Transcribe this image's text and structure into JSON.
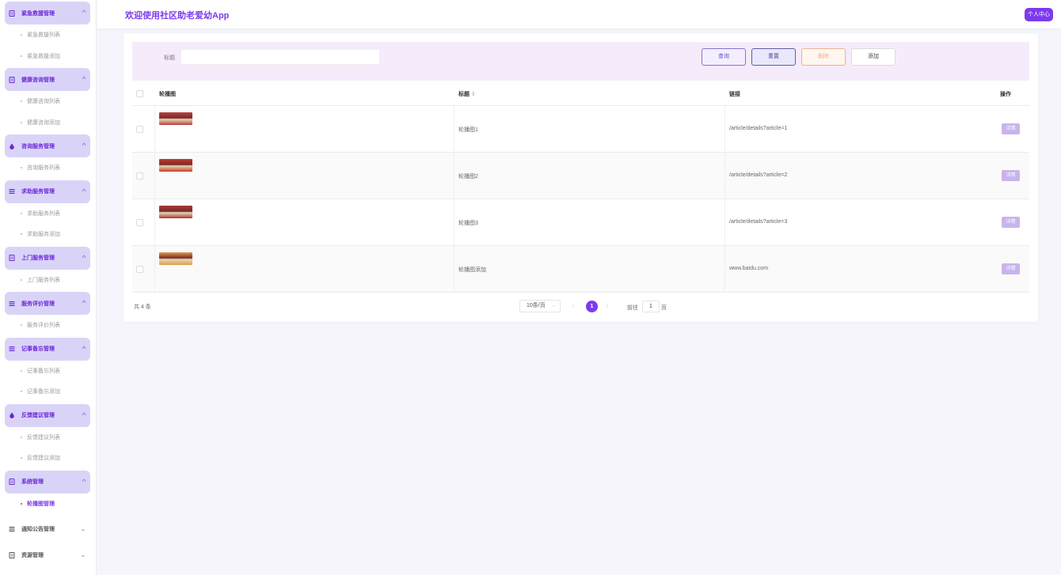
{
  "header": {
    "app_title": "欢迎使用社区助老爱幼App",
    "profile_button": "个人中心"
  },
  "sidebar": {
    "groups": [
      {
        "title": "紧急救援管理",
        "icon": "doc-icon",
        "items": [
          "紧急救援列表",
          "紧急救援添加"
        ]
      },
      {
        "title": "健康咨询管理",
        "icon": "doc-icon",
        "items": [
          "健康咨询列表",
          "健康咨询添加"
        ]
      },
      {
        "title": "咨询服务管理",
        "icon": "drop-icon",
        "items": [
          "咨询服务列表"
        ]
      },
      {
        "title": "求助服务管理",
        "icon": "list-icon",
        "items": [
          "求助服务列表",
          "求助服务添加"
        ]
      },
      {
        "title": "上门服务管理",
        "icon": "doc-icon",
        "items": [
          "上门服务列表"
        ]
      },
      {
        "title": "服务评价管理",
        "icon": "list-icon",
        "items": [
          "服务评价列表"
        ]
      },
      {
        "title": "记事备忘管理",
        "icon": "list-icon",
        "items": [
          "记事备忘列表",
          "记事备忘添加"
        ]
      },
      {
        "title": "反馈建议管理",
        "icon": "drop-icon",
        "items": [
          "反馈建议列表",
          "反馈建议添加"
        ]
      },
      {
        "title": "系统管理",
        "icon": "doc-icon",
        "items": [
          "轮播图管理"
        ]
      },
      {
        "title": "通知公告管理",
        "icon": "list-icon",
        "items": []
      },
      {
        "title": "资源管理",
        "icon": "doc-icon",
        "items": []
      }
    ],
    "active_item": "轮播图管理"
  },
  "search": {
    "label": "标题",
    "value": "",
    "query_button": "查询",
    "reset_button": "重置",
    "delete_button": "删除",
    "add_button": "添加"
  },
  "table": {
    "headers": {
      "image": "轮播图",
      "title": "标题",
      "sort_icon": "⇕",
      "link": "链接",
      "action": "操作"
    },
    "rows": [
      {
        "title": "轮播图1",
        "link": "/article/details?article=1",
        "action": "详情",
        "thumb": "#b84040"
      },
      {
        "title": "轮播图2",
        "link": "/article/details?article=2",
        "action": "详情",
        "thumb": "#c83a2a"
      },
      {
        "title": "轮播图3",
        "link": "/article/details?article=3",
        "action": "详情",
        "thumb": "#a83838"
      },
      {
        "title": "轮播图添加",
        "link": "www.baidu.com",
        "action": "详情",
        "thumb": "#d9a050"
      }
    ]
  },
  "pagination": {
    "total": "共 4 条",
    "page_size": "10条/页",
    "current_page": "1",
    "goto_label": "前往",
    "goto_value": "1",
    "goto_suffix": "页"
  },
  "colors": {
    "accent": "#7c3aed",
    "menu_bg": "#d9d4f7",
    "search_bg": "#f6ebfb"
  }
}
